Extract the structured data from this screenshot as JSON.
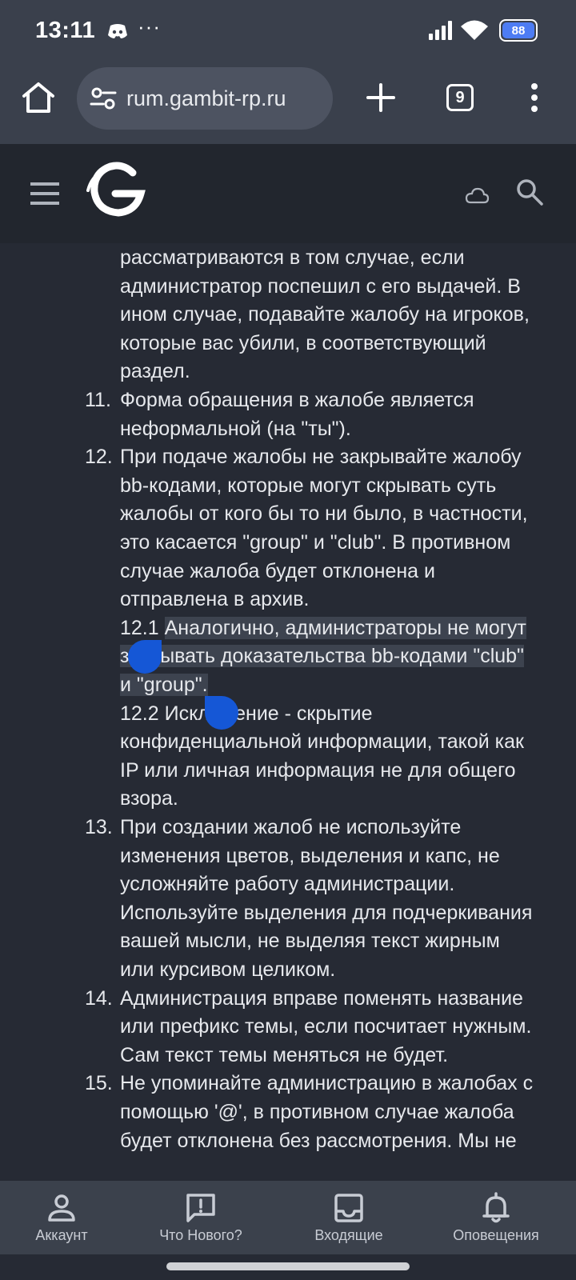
{
  "status_bar": {
    "time": "13:11",
    "more": "···",
    "battery": "88"
  },
  "browser": {
    "url": "rum.gambit-rp.ru",
    "tab_count": "9"
  },
  "colors": {
    "accent": "#4d7cf3",
    "selection_handle": "#1557d6",
    "background": "#262a34"
  },
  "article": {
    "lines": [
      {
        "num": "",
        "text": "рассматриваются в том случае, если",
        "hl": ""
      },
      {
        "num": "",
        "text": "администратор поспешил с его выдачей. В",
        "hl": ""
      },
      {
        "num": "",
        "text": "ином случае, подавайте жалобу на игроков,",
        "hl": ""
      },
      {
        "num": "",
        "text": "которые вас убили, в соответствующий",
        "hl": ""
      },
      {
        "num": "",
        "text": "раздел.",
        "hl": ""
      },
      {
        "num": "11.",
        "text": "Форма обращения в жалобе является",
        "hl": ""
      },
      {
        "num": "",
        "text": "неформальной (на \"ты\").",
        "hl": ""
      },
      {
        "num": "12.",
        "text": "При подаче жалобы не закрывайте жалобу",
        "hl": ""
      },
      {
        "num": "",
        "text": "bb-кодами, которые могут скрывать суть",
        "hl": ""
      },
      {
        "num": "",
        "text": "жалобы от кого бы то ни было, в частности,",
        "hl": ""
      },
      {
        "num": "",
        "text": "это касается \"group\" и \"club\". В противном",
        "hl": ""
      },
      {
        "num": "",
        "text": "случае жалоба будет отклонена и",
        "hl": ""
      },
      {
        "num": "",
        "text": "отправлена в архив.",
        "hl": ""
      },
      {
        "num": "",
        "text": "12.1 ",
        "hl": "Аналогично, администраторы не могут"
      },
      {
        "num": "",
        "text": "",
        "hl": "закрывать доказательства bb-кодами \"club\""
      },
      {
        "num": "",
        "text": "",
        "hl": "и \"group\"."
      },
      {
        "num": "",
        "text": "12.2 Исключение - скрытие",
        "hl": ""
      },
      {
        "num": "",
        "text": "конфиденциальной информации, такой как",
        "hl": ""
      },
      {
        "num": "",
        "text": "IP или личная информация не для общего",
        "hl": ""
      },
      {
        "num": "",
        "text": "взора.",
        "hl": ""
      },
      {
        "num": "13.",
        "text": "При создании жалоб не используйте",
        "hl": ""
      },
      {
        "num": "",
        "text": "изменения цветов, выделения и капс, не",
        "hl": ""
      },
      {
        "num": "",
        "text": "усложняйте работу администрации.",
        "hl": ""
      },
      {
        "num": "",
        "text": "Используйте выделения для подчеркивания",
        "hl": ""
      },
      {
        "num": "",
        "text": "вашей мысли, не выделяя текст жирным",
        "hl": ""
      },
      {
        "num": "",
        "text": "или курсивом целиком.",
        "hl": ""
      },
      {
        "num": "14.",
        "text": "Администрация вправе поменять название",
        "hl": ""
      },
      {
        "num": "",
        "text": "или префикс темы, если посчитает нужным.",
        "hl": ""
      },
      {
        "num": "",
        "text": "Сам текст темы меняться не будет.",
        "hl": ""
      },
      {
        "num": "15.",
        "text": "Не упоминайте администрацию в жалобах с",
        "hl": ""
      },
      {
        "num": "",
        "text": "помощью '@', в противном случае жалоба",
        "hl": ""
      },
      {
        "num": "",
        "text": "будет отклонена без рассмотрения. Мы не",
        "hl": ""
      }
    ]
  },
  "bottom_nav": {
    "items": [
      {
        "label": "Аккаунт",
        "icon": "account-icon"
      },
      {
        "label": "Что Нового?",
        "icon": "whats-new-icon"
      },
      {
        "label": "Входящие",
        "icon": "inbox-icon"
      },
      {
        "label": "Оповещения",
        "icon": "bell-icon"
      }
    ]
  }
}
